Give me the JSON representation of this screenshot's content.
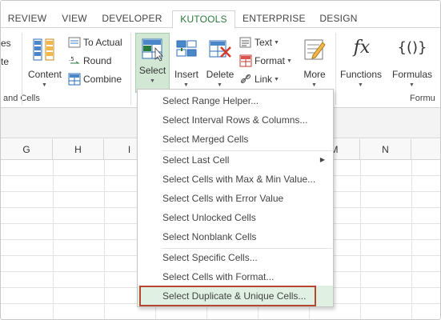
{
  "tabs": [
    "REVIEW",
    "VIEW",
    "DEVELOPER",
    "KUTOOLS",
    "ENTERPRISE",
    "DESIGN"
  ],
  "ribbon": {
    "left_items": [
      "es",
      "te"
    ],
    "content_label": "Content",
    "to_actual": "To Actual",
    "round": "Round",
    "combine": "Combine",
    "select_label": "Select",
    "insert_label": "Insert",
    "delete_label": "Delete",
    "text_label": "Text",
    "format_label": "Format",
    "link_label": "Link",
    "more_label": "More",
    "functions_label": "Functions",
    "formulas_label": "Formulas",
    "group_ranges_cells": "and Cells",
    "group_formula": "Formu",
    "fx_glyph": "fx",
    "braces_glyph": "{()}"
  },
  "columns": [
    "G",
    "H",
    "I",
    "M",
    "N"
  ],
  "menu": {
    "items": [
      "Select Range Helper...",
      "Select Interval Rows & Columns...",
      "Select Merged Cells",
      "Select Last Cell",
      "Select Cells with Max & Min Value...",
      "Select Cells with Error Value",
      "Select Unlocked Cells",
      "Select Nonblank Cells",
      "Select Specific Cells...",
      "Select Cells with Format...",
      "Select Duplicate & Unique Cells..."
    ]
  },
  "colors": {
    "accent_green": "#2a7a3c",
    "select_bg": "#d2e8d4",
    "highlight_border": "#b8472f"
  }
}
